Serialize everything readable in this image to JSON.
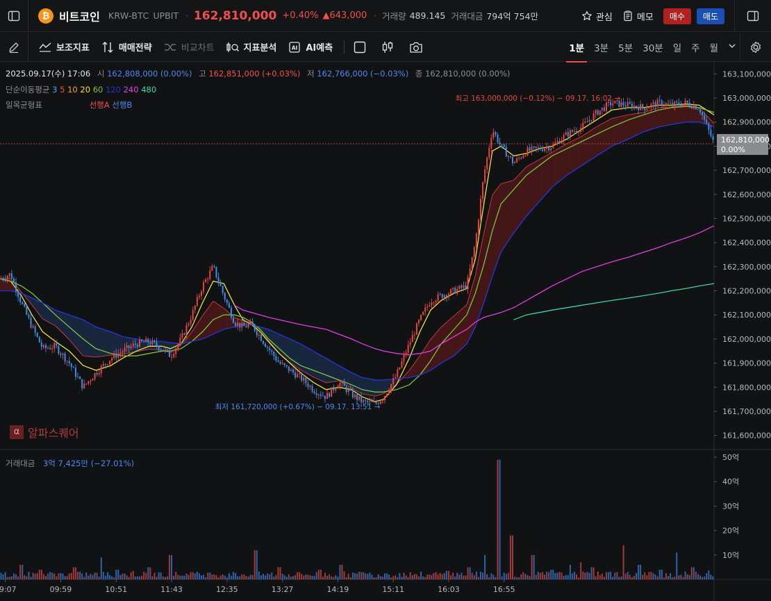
{
  "header": {
    "coin_logo_glyph": "₿",
    "coin_name": "비트코인",
    "pair": "KRW-BTC",
    "market": "UPBIT",
    "price": "162,810,000",
    "change_pct": "+0.40%",
    "change_abs": "▲643,000",
    "volume_label": "거래량",
    "volume_value": "489.145",
    "trade_amount_label": "거래대금",
    "trade_amount_value": "794억 754만",
    "watch_label": "관심",
    "memo_label": "메모",
    "buy_label": "매수",
    "sell_label": "매도"
  },
  "toolbar": {
    "indicators": "보조지표",
    "strategy": "매매전략",
    "compare": "비교차트",
    "analysis": "지표분석",
    "ai_badge": "AI",
    "ai_predict": "AI예측",
    "intervals": [
      "1분",
      "3분",
      "5분",
      "30분",
      "일",
      "주",
      "월"
    ],
    "active_interval": "1분"
  },
  "ohlc": {
    "datetime": "2025.09.17(수) 17:06",
    "open_label": "시",
    "open": "162,808,000 (0.00%)",
    "high_label": "고",
    "high": "162,851,000 (+0.03%)",
    "low_label": "저",
    "low": "162,766,000 (−0.03%)",
    "close_label": "종",
    "close": "162,810,000 (0.00%)"
  },
  "ma_legend": {
    "label": "단순이동평균",
    "periods": [
      {
        "p": "3",
        "color": "#4aa8f0"
      },
      {
        "p": "5",
        "color": "#f0504d"
      },
      {
        "p": "10",
        "color": "#f5a623"
      },
      {
        "p": "20",
        "color": "#f3e03a"
      },
      {
        "p": "60",
        "color": "#7cc43c"
      },
      {
        "p": "120",
        "color": "#2233d6"
      },
      {
        "p": "240",
        "color": "#e23ee2"
      },
      {
        "p": "480",
        "color": "#3ad6a6"
      }
    ]
  },
  "ichimoku": {
    "label": "일목균형표",
    "span_a": "선행A",
    "span_b": "선행B"
  },
  "annotations": {
    "high": "최고 163,000,000 (−0.12%) − 09.17. 16:02 →",
    "low": "최저 161,720,000 (+0.67%) − 09.17. 13:51 →",
    "last_price": "162,810,000",
    "last_pct": "0.00%"
  },
  "watermark": {
    "icon_glyph": "α",
    "text": "알파스퀘어"
  },
  "volume_pane": {
    "label": "거래대금",
    "value": "3억 7,425만 (−27.01%)"
  },
  "chart_data": {
    "type": "line",
    "title": "",
    "x_ticks": [
      "09:07",
      "09:59",
      "10:51",
      "11:43",
      "12:35",
      "13:27",
      "14:19",
      "15:11",
      "16:03",
      "16:55"
    ],
    "y_ticks": [
      163100000,
      163000000,
      162900000,
      162800000,
      162700000,
      162600000,
      162500000,
      162400000,
      162300000,
      162200000,
      162100000,
      162000000,
      161900000,
      161800000,
      161700000,
      161600000
    ],
    "ylim": [
      161550000,
      163150000
    ],
    "price_series": {
      "name": "",
      "x_minutes": [
        0,
        10,
        20,
        30,
        40,
        52,
        65,
        78,
        90,
        104,
        115,
        128,
        140,
        152,
        160,
        170,
        180,
        190,
        200,
        210,
        220,
        228,
        236,
        244,
        252,
        262,
        272,
        282,
        294,
        306,
        318,
        330,
        340,
        352,
        360,
        372,
        384,
        394,
        404,
        414,
        426,
        438,
        446,
        454,
        462,
        470,
        482,
        494,
        506,
        518,
        532,
        546,
        560,
        574,
        590,
        604,
        618,
        630,
        644,
        656,
        670
      ],
      "close": [
        162250000,
        162270000,
        162150000,
        162050000,
        161960000,
        161970000,
        161900000,
        161800000,
        161860000,
        161920000,
        161950000,
        161980000,
        161990000,
        161960000,
        161930000,
        162000000,
        162100000,
        162220000,
        162300000,
        162180000,
        162070000,
        162050000,
        162060000,
        162010000,
        161960000,
        161900000,
        161870000,
        161840000,
        161790000,
        161760000,
        161820000,
        161770000,
        161740000,
        161730000,
        161760000,
        161850000,
        161980000,
        162080000,
        162160000,
        162180000,
        162200000,
        162220000,
        162400000,
        162680000,
        162870000,
        162800000,
        162730000,
        162780000,
        162790000,
        162800000,
        162850000,
        162880000,
        162940000,
        162980000,
        162970000,
        162960000,
        162980000,
        162970000,
        162980000,
        162960000,
        162810000
      ]
    },
    "moving_averages": [
      {
        "name": "20",
        "color": "#f3e03a",
        "values": [
          162250000,
          162240000,
          162180000,
          162100000,
          162030000,
          161990000,
          161950000,
          161890000,
          161870000,
          161890000,
          161920000,
          161950000,
          161970000,
          161970000,
          161960000,
          161980000,
          162050000,
          162150000,
          162240000,
          162230000,
          162140000,
          162080000,
          162060000,
          162030000,
          161990000,
          161940000,
          161900000,
          161860000,
          161820000,
          161790000,
          161800000,
          161790000,
          161760000,
          161740000,
          161750000,
          161810000,
          161920000,
          162030000,
          162120000,
          162160000,
          162190000,
          162210000,
          162330000,
          162560000,
          162780000,
          162800000,
          162760000,
          162770000,
          162790000,
          162800000,
          162830000,
          162870000,
          162910000,
          162950000,
          162960000,
          162960000,
          162970000,
          162970000,
          162975000,
          162970000,
          162930000
        ]
      },
      {
        "name": "60",
        "color": "#7cc43c",
        "values": [
          162250000,
          162240000,
          162220000,
          162190000,
          162150000,
          162100000,
          162050000,
          162000000,
          161960000,
          161940000,
          161930000,
          161930000,
          161940000,
          161950000,
          161950000,
          161960000,
          161990000,
          162030000,
          162080000,
          162100000,
          162100000,
          162090000,
          162070000,
          162040000,
          162000000,
          161960000,
          161920000,
          161890000,
          161870000,
          161850000,
          161830000,
          161810000,
          161790000,
          161780000,
          161780000,
          161790000,
          161810000,
          161850000,
          161910000,
          161980000,
          162040000,
          162100000,
          162190000,
          162310000,
          162450000,
          162560000,
          162620000,
          162680000,
          162720000,
          162760000,
          162790000,
          162820000,
          162850000,
          162880000,
          162910000,
          162930000,
          162950000,
          162960000,
          162965000,
          162960000,
          162940000
        ]
      },
      {
        "name": "120",
        "color": "#2233d6",
        "values": [
          162200000,
          162200000,
          162190000,
          162170000,
          162150000,
          162120000,
          162100000,
          162080000,
          162050000,
          162030000,
          162010000,
          162000000,
          161990000,
          161990000,
          161985000,
          161980000,
          161990000,
          162000000,
          162020000,
          162040000,
          162050000,
          162060000,
          162060000,
          162050000,
          162040000,
          162020000,
          162000000,
          161980000,
          161950000,
          161920000,
          161890000,
          161860000,
          161840000,
          161830000,
          161830000,
          161835000,
          161840000,
          161850000,
          161870000,
          161900000,
          161930000,
          161980000,
          162050000,
          162150000,
          162260000,
          162360000,
          162440000,
          162510000,
          162570000,
          162630000,
          162680000,
          162720000,
          162760000,
          162800000,
          162830000,
          162860000,
          162880000,
          162890000,
          162900000,
          162900000,
          162880000
        ]
      },
      {
        "name": "240",
        "color": "#e23ee2",
        "values": [
          null,
          null,
          null,
          null,
          null,
          null,
          null,
          null,
          null,
          null,
          null,
          null,
          null,
          null,
          null,
          null,
          null,
          null,
          null,
          null,
          162140000,
          162120000,
          162110000,
          162100000,
          162090000,
          162080000,
          162070000,
          162060000,
          162050000,
          162040000,
          162020000,
          162000000,
          161980000,
          161960000,
          161950000,
          161940000,
          161935000,
          161940000,
          161950000,
          161980000,
          162010000,
          162040000,
          162070000,
          162090000,
          162100000,
          162110000,
          162130000,
          162160000,
          162190000,
          162220000,
          162250000,
          162280000,
          162300000,
          162320000,
          162340000,
          162360000,
          162380000,
          162400000,
          162420000,
          162440000,
          162470000
        ]
      },
      {
        "name": "480",
        "color": "#3ad6a6",
        "values": [
          null,
          null,
          null,
          null,
          null,
          null,
          null,
          null,
          null,
          null,
          null,
          null,
          null,
          null,
          null,
          null,
          null,
          null,
          null,
          null,
          null,
          null,
          null,
          null,
          null,
          null,
          null,
          null,
          null,
          null,
          null,
          null,
          null,
          null,
          null,
          null,
          null,
          null,
          null,
          null,
          null,
          null,
          null,
          null,
          null,
          null,
          162080000,
          162100000,
          162110000,
          162120000,
          162130000,
          162140000,
          162150000,
          162160000,
          162170000,
          162180000,
          162190000,
          162200000,
          162210000,
          162220000,
          162230000
        ]
      }
    ],
    "volume_ticks": [
      "50억",
      "40억",
      "30억",
      "20억",
      "10억"
    ],
    "volume_ylim": [
      0,
      5200000000
    ],
    "volume_series": {
      "name": "거래대금",
      "x_minutes": [
        5,
        20,
        38,
        55,
        70,
        95,
        110,
        125,
        140,
        160,
        180,
        200,
        215,
        240,
        262,
        280,
        300,
        320,
        340,
        362,
        385,
        402,
        420,
        440,
        455,
        468,
        480,
        500,
        518,
        535,
        545,
        556,
        570,
        585,
        600,
        620,
        635,
        650,
        665
      ],
      "values": [
        300000000,
        600000000,
        400000000,
        250000000,
        500000000,
        900000000,
        400000000,
        350000000,
        500000000,
        1000000000,
        300000000,
        200000000,
        250000000,
        1200000000,
        500000000,
        300000000,
        400000000,
        600000000,
        300000000,
        250000000,
        300000000,
        200000000,
        350000000,
        500000000,
        1000000000,
        4900000000,
        1800000000,
        1000000000,
        400000000,
        600000000,
        700000000,
        500000000,
        300000000,
        1400000000,
        600000000,
        400000000,
        1100000000,
        500000000,
        374250000
      ]
    }
  }
}
